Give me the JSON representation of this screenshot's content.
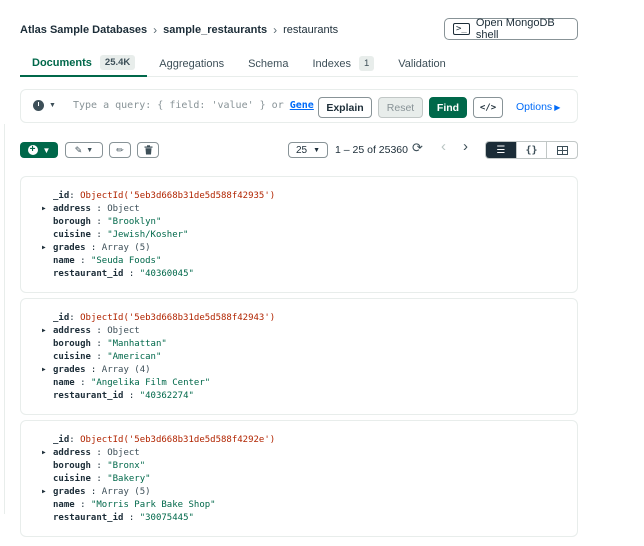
{
  "breadcrumb": {
    "database_group": "Atlas Sample Databases",
    "database": "sample_restaurants",
    "collection": "restaurants"
  },
  "shell_button": {
    "icon": ">_",
    "label": "Open MongoDB shell"
  },
  "tabs": [
    {
      "label": "Documents",
      "count": "25.4K"
    },
    {
      "label": "Aggregations"
    },
    {
      "label": "Schema"
    },
    {
      "label": "Indexes",
      "count": "1"
    },
    {
      "label": "Validation"
    }
  ],
  "query": {
    "placeholder": "Type a query: { field: 'value' } or",
    "generate_link": "Gene",
    "explain_label": "Explain",
    "reset_label": "Reset",
    "find_label": "Find",
    "code_label": "</>",
    "options_label": "Options"
  },
  "pager": {
    "page_size": "25",
    "range_text": "1 – 25 of 25360"
  },
  "documents": [
    {
      "id": "ObjectId('5eb3d668b31de5d588f42935')",
      "fields": [
        {
          "key": "address",
          "value": "Object",
          "expandable": true,
          "type": "plain"
        },
        {
          "key": "borough",
          "value": "\"Brooklyn\"",
          "type": "str"
        },
        {
          "key": "cuisine",
          "value": "\"Jewish/Kosher\"",
          "type": "str"
        },
        {
          "key": "grades",
          "value": "Array (5)",
          "expandable": true,
          "type": "plain"
        },
        {
          "key": "name",
          "value": "\"Seuda Foods\"",
          "type": "str"
        },
        {
          "key": "restaurant_id",
          "value": "\"40360045\"",
          "type": "str"
        }
      ]
    },
    {
      "id": "ObjectId('5eb3d668b31de5d588f42943')",
      "fields": [
        {
          "key": "address",
          "value": "Object",
          "expandable": true,
          "type": "plain"
        },
        {
          "key": "borough",
          "value": "\"Manhattan\"",
          "type": "str"
        },
        {
          "key": "cuisine",
          "value": "\"American\"",
          "type": "str"
        },
        {
          "key": "grades",
          "value": "Array (4)",
          "expandable": true,
          "type": "plain"
        },
        {
          "key": "name",
          "value": "\"Angelika Film Center\"",
          "type": "str"
        },
        {
          "key": "restaurant_id",
          "value": "\"40362274\"",
          "type": "str"
        }
      ]
    },
    {
      "id": "ObjectId('5eb3d668b31de5d588f4292e')",
      "fields": [
        {
          "key": "address",
          "value": "Object",
          "expandable": true,
          "type": "plain"
        },
        {
          "key": "borough",
          "value": "\"Bronx\"",
          "type": "str"
        },
        {
          "key": "cuisine",
          "value": "\"Bakery\"",
          "type": "str"
        },
        {
          "key": "grades",
          "value": "Array (5)",
          "expandable": true,
          "type": "plain"
        },
        {
          "key": "name",
          "value": "\"Morris Park Bake Shop\"",
          "type": "str"
        },
        {
          "key": "restaurant_id",
          "value": "\"30075445\"",
          "type": "str"
        }
      ]
    }
  ],
  "id_key": "_id",
  "colors": {
    "brand_green": "#00684a",
    "link_blue": "#016bf8",
    "objectid_red": "#b12400",
    "text_dark": "#1c2d38"
  }
}
